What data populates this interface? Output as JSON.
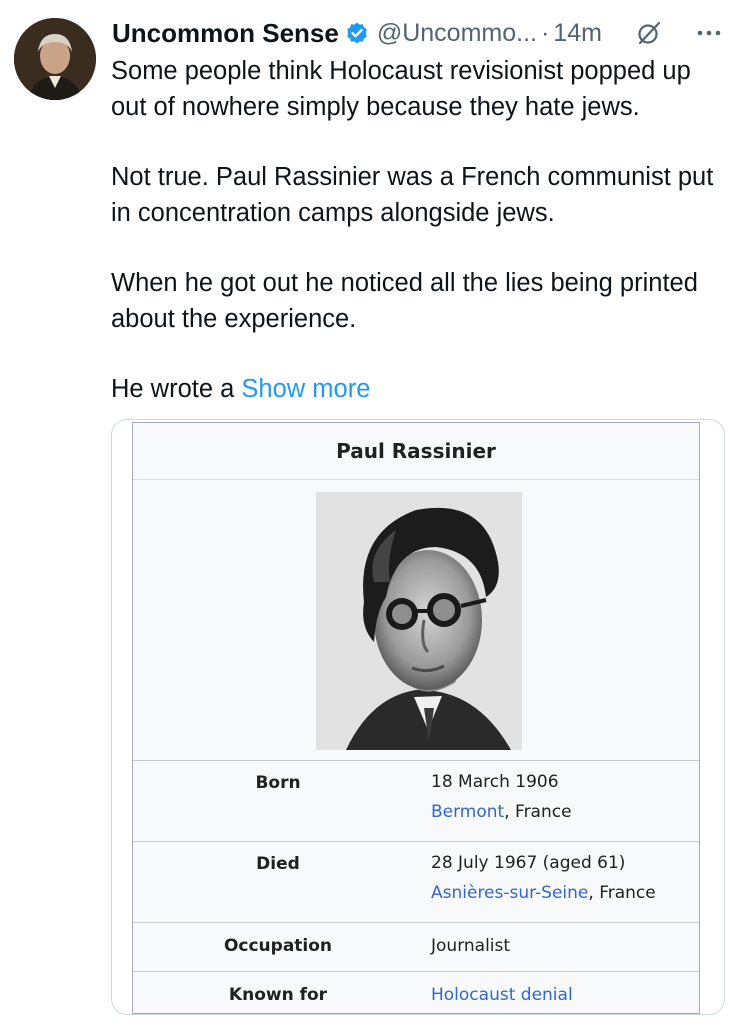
{
  "author": {
    "name": "Uncommon Sense",
    "handle": "@Uncommo...",
    "separator": "·",
    "time": "14m"
  },
  "tweet": {
    "paragraphs": [
      "Some people think Holocaust revisionist popped up out of nowhere simply because they hate jews.",
      "Not true. Paul Rassinier was a French communist put in concentration camps alongside jews.",
      "When he got out he noticed all the lies being printed about the experience."
    ],
    "truncated": "He wrote a",
    "show_more": "Show more"
  },
  "infobox": {
    "title": "Paul Rassinier",
    "rows": [
      {
        "label": "Born",
        "line1": "18 March 1906",
        "link": "Bermont",
        "rest": ", France"
      },
      {
        "label": "Died",
        "line1": "28 July 1967 (aged 61)",
        "link": "Asnières-sur-Seine",
        "rest": ", France"
      },
      {
        "label": "Occupation",
        "value": "Journalist"
      },
      {
        "label": "Known for",
        "link": "Holocaust denial"
      }
    ]
  },
  "colors": {
    "accent": "#1d9bf0",
    "text": "#0f1419",
    "muted": "#536471",
    "wiki_link": "#3366cc",
    "verified_badge": "#1d9bf0"
  },
  "icons": [
    "avatar-portrait",
    "verified-badge-icon",
    "grok-icon",
    "more-options-icon"
  ]
}
